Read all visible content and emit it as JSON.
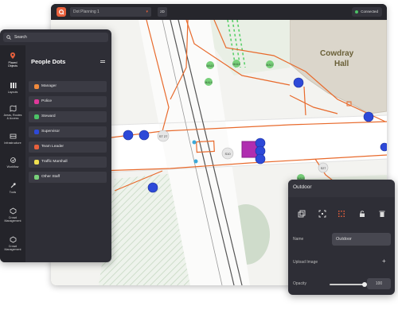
{
  "topbar": {
    "plan_name": "Dot Planning 1",
    "view_mode": "2D",
    "status": "Connected",
    "status_color": "#4cc266",
    "brand_color": "#e8603c"
  },
  "map": {
    "building_label_line1": "Cowdray",
    "building_label_line2": "Hall",
    "stewards": [
      "MA15",
      "MA16",
      "MA17",
      "MA18",
      "MA14"
    ],
    "staff_tags": [
      "ST 27",
      "S10",
      "S27"
    ]
  },
  "sidebar": {
    "search_placeholder": "Search",
    "rail": [
      {
        "label1": "Placed",
        "label2": "Objects",
        "icon": "pin-icon"
      },
      {
        "label1": "Layouts",
        "label2": "",
        "icon": "layouts-icon"
      },
      {
        "label1": "Areas, Routes",
        "label2": "& Access",
        "icon": "routes-icon"
      },
      {
        "label1": "Infrastructure",
        "label2": "",
        "icon": "infrastructure-icon"
      },
      {
        "label1": "Workflow",
        "label2": "",
        "icon": "workflow-icon"
      },
      {
        "label1": "Tools",
        "label2": "",
        "icon": "tools-icon"
      },
      {
        "label1": "Crowd",
        "label2": "Management",
        "icon": "crowd-icon"
      },
      {
        "label1": "Crowd",
        "label2": "Management",
        "icon": "crowd-icon"
      }
    ],
    "panel_title": "People Dots",
    "dots": [
      {
        "label": "Manager",
        "color": "#f08a3c"
      },
      {
        "label": "Police",
        "color": "#e0389a"
      },
      {
        "label": "Steward",
        "color": "#4cc266"
      },
      {
        "label": "Supervisor",
        "color": "#2d49d8"
      },
      {
        "label": "Team Leader",
        "color": "#e8603c"
      },
      {
        "label": "Traffic Marshall",
        "color": "#f0e050"
      },
      {
        "label": "Other Staff",
        "color": "#78d07a"
      }
    ]
  },
  "properties": {
    "title": "Outdoor",
    "name_label": "Name",
    "name_value": "Outdoor",
    "upload_label": "Upload Image",
    "upload_plus": "+",
    "opacity_label": "Opacity",
    "opacity_value": "100"
  }
}
